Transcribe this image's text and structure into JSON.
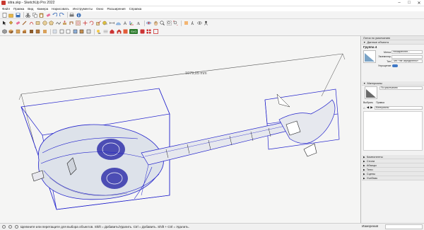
{
  "window": {
    "title": "sitra.skp - SketchUp Pro 2022"
  },
  "menu": [
    "Файл",
    "Правка",
    "Вид",
    "Камера",
    "Нарисовать",
    "Инструменты",
    "Окно",
    "Расширения",
    "Справка"
  ],
  "viewport": {
    "dimension_label": "1079,05 mm"
  },
  "tray": {
    "title": "Лоток по умолчанию",
    "entity_info": {
      "header": "Данные объекта",
      "entity_type": "Группа 4",
      "layer_label": "Метка",
      "layer_value": "Незакреплен...",
      "instance_label": "Экземпляр",
      "type_label": "Тип",
      "type_value": "Тип: «не определено»",
      "toggle_label": "Упрощение"
    },
    "materials": {
      "header": "Материалы",
      "name_placeholder": "По умолчанию",
      "tab_select": "Выбрать",
      "tab_edit": "Правка",
      "collection": "Материалы"
    },
    "sections": [
      "Компоненты",
      "Стили",
      "Абзацы",
      "Тени",
      "Сцены",
      "Учебник"
    ]
  },
  "statusbar": {
    "hint": "Щелкните или перетащите для выбора объектов. Shift = Добавить/Удалить. Ctrl = Добавить. Shift + Ctrl = Удалить.",
    "measure_label": "Измерения"
  },
  "colors": {
    "selection": "#2222cc",
    "axis_red": "#cc2222",
    "axis_green": "#229922",
    "brand": "#c8382f"
  }
}
